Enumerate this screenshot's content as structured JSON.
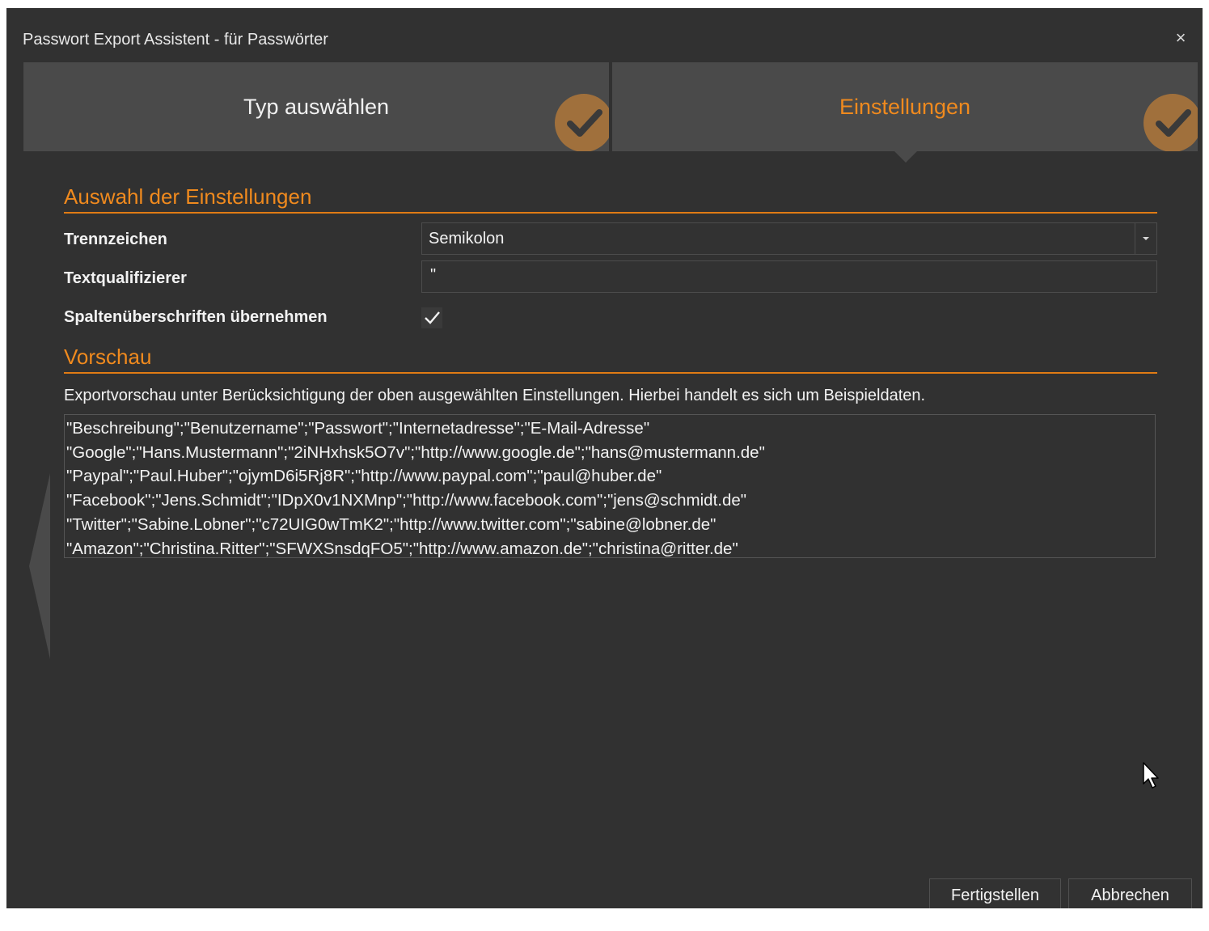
{
  "window": {
    "title": "Passwort Export Assistent - für Passwörter",
    "close_glyph": "×"
  },
  "steps": [
    {
      "label": "Typ auswählen",
      "state": "completed",
      "icon": "check-circle-icon"
    },
    {
      "label": "Einstellungen",
      "state": "active",
      "icon": "check-circle-icon"
    }
  ],
  "settings": {
    "heading": "Auswahl der Einstellungen",
    "separator_label": "Trennzeichen",
    "separator_value": "Semikolon",
    "qualifier_label": "Textqualifizierer",
    "qualifier_value": "\"",
    "headers_label": "Spaltenüberschriften übernehmen",
    "headers_checked": true
  },
  "preview": {
    "heading": "Vorschau",
    "description": "Exportvorschau unter Berücksichtigung der oben ausgewählten Einstellungen. Hierbei handelt es sich um Beispieldaten.",
    "lines": [
      "\"Beschreibung\";\"Benutzername\";\"Passwort\";\"Internetadresse\";\"E-Mail-Adresse\"",
      "\"Google\";\"Hans.Mustermann\";\"2iNHxhsk5O7v\";\"http://www.google.de\";\"hans@mustermann.de\"",
      "\"Paypal\";\"Paul.Huber\";\"ojymD6i5Rj8R\";\"http://www.paypal.com\";\"paul@huber.de\"",
      "\"Facebook\";\"Jens.Schmidt\";\"IDpX0v1NXMnp\";\"http://www.facebook.com\";\"jens@schmidt.de\"",
      "\"Twitter\";\"Sabine.Lobner\";\"c72UIG0wTmK2\";\"http://www.twitter.com\";\"sabine@lobner.de\"",
      "\"Amazon\";\"Christina.Ritter\";\"SFWXSnsdqFO5\";\"http://www.amazon.de\";\"christina@ritter.de\""
    ]
  },
  "buttons": {
    "finish": "Fertigstellen",
    "cancel": "Abbrechen"
  },
  "colors": {
    "background": "#313131",
    "accent": "#f08a1e",
    "step_background": "#4a4a4a"
  }
}
